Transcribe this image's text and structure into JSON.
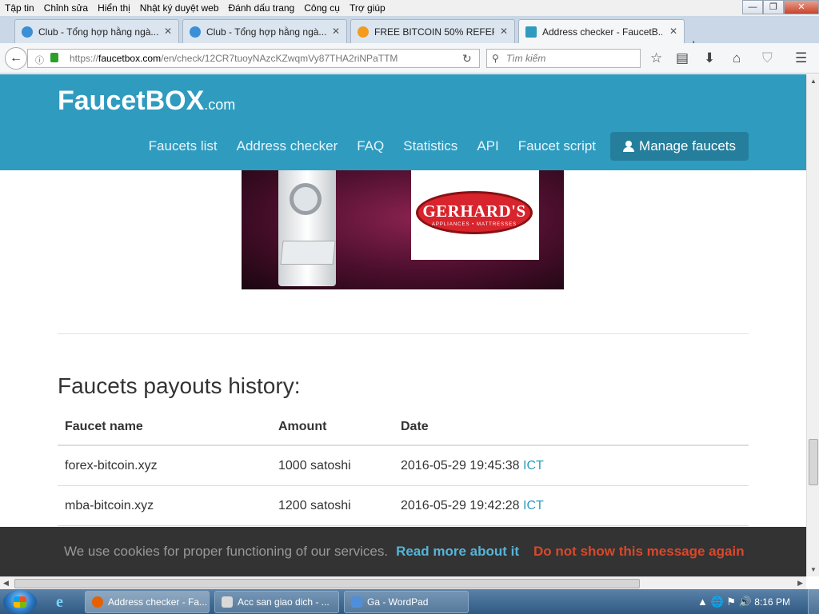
{
  "menu": [
    "Tập tin",
    "Chỉnh sửa",
    "Hiển thị",
    "Nhật ký duyệt web",
    "Đánh dấu trang",
    "Công cụ",
    "Trợ giúp"
  ],
  "tabs": [
    {
      "label": "Club - Tổng hợp hằng ngà...",
      "color": "#3a8fd6"
    },
    {
      "label": "Club - Tổng hợp hằng ngà...",
      "color": "#3a8fd6"
    },
    {
      "label": "FREE BITCOIN 50% REFERR...",
      "color": "#f39a1f"
    },
    {
      "label": "Address checker - FaucetB...",
      "color": "#2e9bbf"
    }
  ],
  "address": {
    "prefix": "https://",
    "domain": "faucetbox.com",
    "path": "/en/check/12CR7tuoyNAzcKZwqmVy87THA2riNPaTTM"
  },
  "search": {
    "placeholder": "Tìm kiếm"
  },
  "site": {
    "logo_main": "FaucetBOX",
    "logo_suffix": ".com",
    "nav": [
      "Faucets list",
      "Address checker",
      "FAQ",
      "Statistics",
      "API",
      "Faucet script"
    ],
    "manage": "Manage faucets"
  },
  "ad": {
    "brand": "GERHARD'S",
    "tagline": "APPLIANCES • MATTRESSES"
  },
  "history": {
    "title": "Faucets payouts history:",
    "headers": [
      "Faucet name",
      "Amount",
      "Date"
    ],
    "rows": [
      {
        "name": "forex-bitcoin.xyz",
        "amount": "1000 satoshi",
        "date": "2016-05-29 19:45:38",
        "tz": "ICT"
      },
      {
        "name": "mba-bitcoin.xyz",
        "amount": "1200 satoshi",
        "date": "2016-05-29 19:42:28",
        "tz": "ICT"
      }
    ]
  },
  "cookie": {
    "message": "We use cookies for proper functioning of our services.",
    "more": "Read more about it",
    "dismiss": "Do not show this message again"
  },
  "taskbar": {
    "items": [
      {
        "label": "Address checker - Fa...",
        "color": "#e66000"
      },
      {
        "label": "Acc san giao dich - ...",
        "color": "#d9d9d9"
      },
      {
        "label": "Ga - WordPad",
        "color": "#4f8fd9"
      }
    ],
    "clock": "8:16 PM"
  }
}
